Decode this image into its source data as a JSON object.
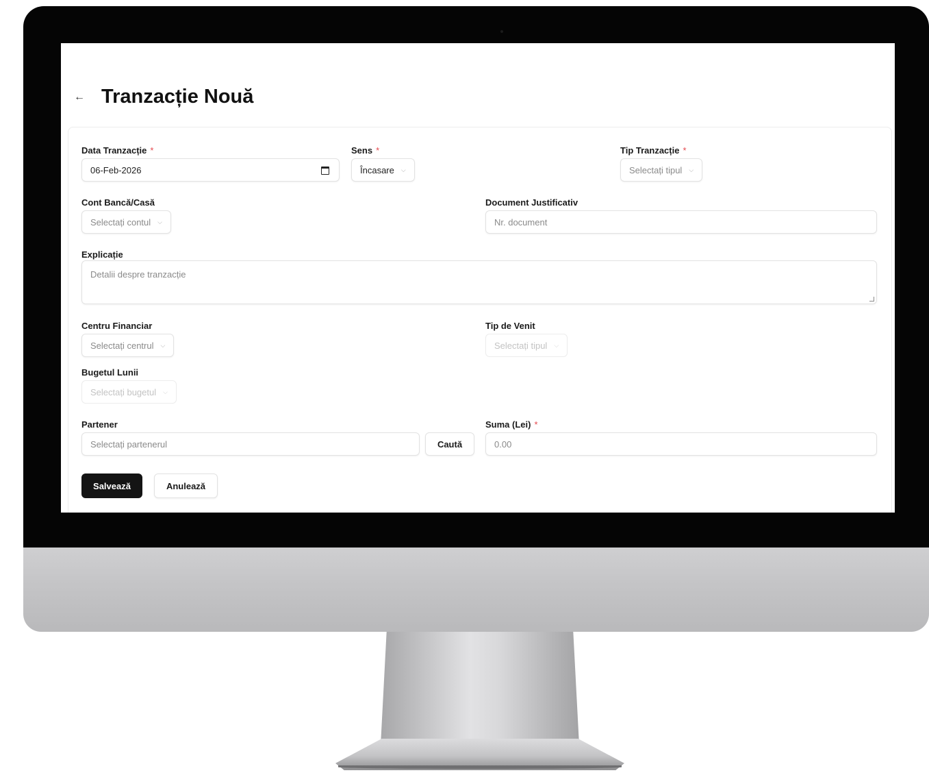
{
  "page": {
    "title": "Tranzacție Nouă",
    "back_icon": "arrow-left-icon"
  },
  "form": {
    "data_tranzactie": {
      "label": "Data Tranzacție",
      "required": "*",
      "value": "06-Feb-2026"
    },
    "sens": {
      "label": "Sens",
      "required": "*",
      "value": "Încasare"
    },
    "tip_tranzactie": {
      "label": "Tip Tranzacție",
      "required": "*",
      "placeholder": "Selectați tipul"
    },
    "cont_banca": {
      "label": "Cont Bancă/Casă",
      "placeholder": "Selectați contul"
    },
    "document_justificativ": {
      "label": "Document Justificativ",
      "placeholder": "Nr. document"
    },
    "explicatie": {
      "label": "Explicație",
      "placeholder": "Detalii despre tranzacție"
    },
    "centru_financiar": {
      "label": "Centru Financiar",
      "placeholder": "Selectați centrul"
    },
    "tip_venit": {
      "label": "Tip de Venit",
      "placeholder": "Selectați tipul",
      "disabled": true
    },
    "bugetul_lunii": {
      "label": "Bugetul Lunii",
      "placeholder": "Selectați bugetul",
      "disabled": true
    },
    "partener": {
      "label": "Partener",
      "placeholder": "Selectați partenerul",
      "search_label": "Caută"
    },
    "suma": {
      "label": "Suma (Lei)",
      "required": "*",
      "placeholder": "0.00"
    }
  },
  "actions": {
    "save_label": "Salvează",
    "cancel_label": "Anulează"
  },
  "colors": {
    "primary_button": "#141414",
    "required_marker": "#e5484d",
    "monitor_bezel": "#050505"
  }
}
